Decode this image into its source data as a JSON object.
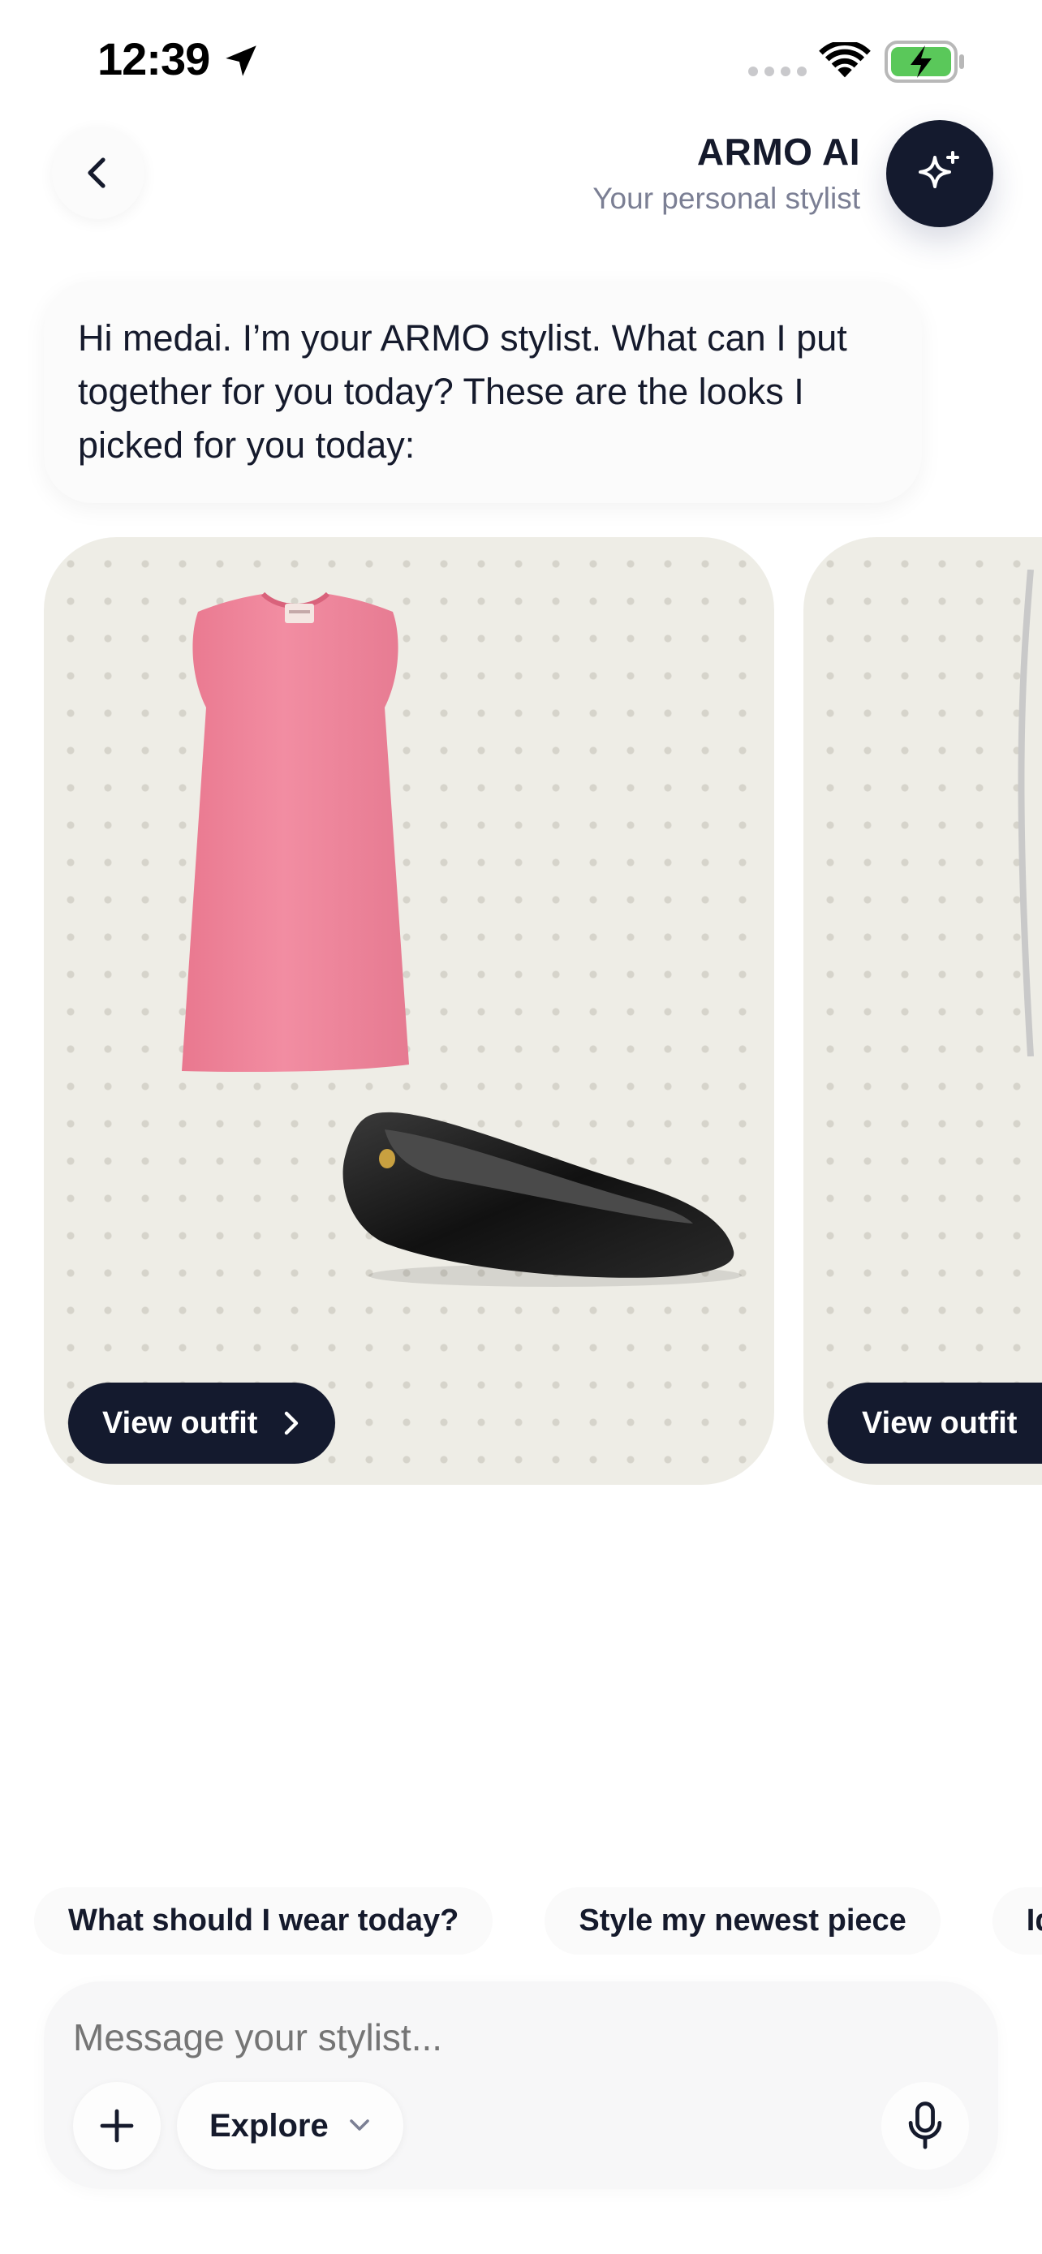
{
  "status_bar": {
    "time": "12:39",
    "location_icon": "location-arrow-icon",
    "wifi_icon": "wifi-icon",
    "battery_icon": "battery-charging-icon"
  },
  "header": {
    "title": "ARMO AI",
    "subtitle": "Your personal stylist",
    "back_icon": "chevron-left-icon",
    "ai_icon": "sparkles-icon"
  },
  "chat": {
    "greeting": "Hi medai. I’m your ARMO stylist. What can I put together for you today? These are the looks I picked for you today:"
  },
  "outfits": [
    {
      "button_label": "View outfit",
      "items": [
        "pink sleeveless dress",
        "black patent ballet flat"
      ]
    },
    {
      "button_label": "View outfit"
    }
  ],
  "suggestions": [
    "What should I wear today?",
    "Style my newest piece",
    "Ideas fo"
  ],
  "composer": {
    "placeholder": "Message your stylist...",
    "explore_label": "Explore"
  },
  "colors": {
    "primary_dark": "#141a2e",
    "card_bg": "#eeede6",
    "dress_pink": "#ee8299",
    "muted_text": "#7b7f94"
  }
}
